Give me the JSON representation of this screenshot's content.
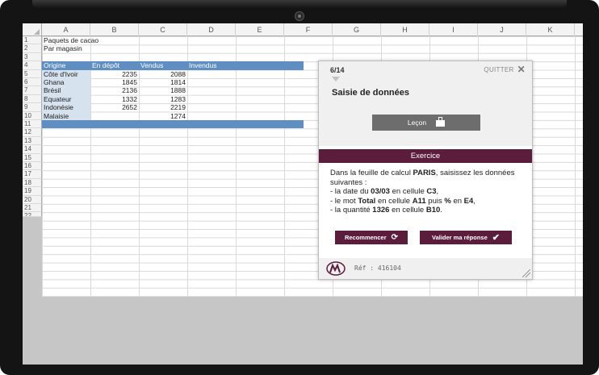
{
  "spreadsheet": {
    "columns": [
      "A",
      "B",
      "C",
      "D",
      "E",
      "F",
      "G",
      "H",
      "I",
      "J",
      "K"
    ],
    "rows": [
      "1",
      "2",
      "3",
      "4",
      "5",
      "6",
      "7",
      "8",
      "9",
      "10",
      "11",
      "12",
      "13",
      "14",
      "15",
      "16",
      "17",
      "18",
      "19",
      "20",
      "21",
      "22"
    ],
    "title": "Paquets de cacao",
    "subtitle": "Par magasin",
    "table_headers": [
      "Origine",
      "En dépôt",
      "Vendus",
      "Invendus"
    ],
    "table_rows": [
      [
        "Côte d'Ivoir",
        "2235",
        "2088"
      ],
      [
        "Ghana",
        "1845",
        "1814"
      ],
      [
        "Brésil",
        "2136",
        "1888"
      ],
      [
        "Equateur",
        "1332",
        "1283"
      ],
      [
        "Indonésie",
        "2652",
        "2219"
      ],
      [
        "Malaisie",
        "",
        "1274"
      ]
    ],
    "colors": {
      "header_band": "#5f8fc2",
      "shade": "#d7e2ef"
    }
  },
  "panel": {
    "pager": "6/14",
    "quit_label": "QUITTER",
    "title": "Saisie de données",
    "lesson_label": "Leçon",
    "exercise_label": "Exercice",
    "instructions": {
      "p1_a": "Dans la feuille de calcul ",
      "p1_b": "PARIS",
      "p1_c": ", saisissez les données suivantes :",
      "l1_a": "- la date du ",
      "l1_b": "03/03",
      "l1_c": " en cellule ",
      "l1_d": "C3",
      "l1_e": ",",
      "l2_a": "- le mot ",
      "l2_b": "Total",
      "l2_c": " en cellule ",
      "l2_d": "A11",
      "l2_e": " puis ",
      "l2_f": "%",
      "l2_g": " en ",
      "l2_h": "E4",
      "l2_i": ",",
      "l3_a": "- la quantité ",
      "l3_b": "1326",
      "l3_c": " en cellule ",
      "l3_d": "B10",
      "l3_e": "."
    },
    "restart_label": "Recommencer",
    "validate_label": "Valider ma réponse",
    "ref": "Réf : 416104",
    "colors": {
      "accent": "#5c1d3d",
      "lesson": "#6d6d6d"
    },
    "icons": [
      "close-icon",
      "briefcase-icon",
      "refresh-icon",
      "check-icon",
      "logo-icon",
      "resize-handle-icon"
    ]
  }
}
